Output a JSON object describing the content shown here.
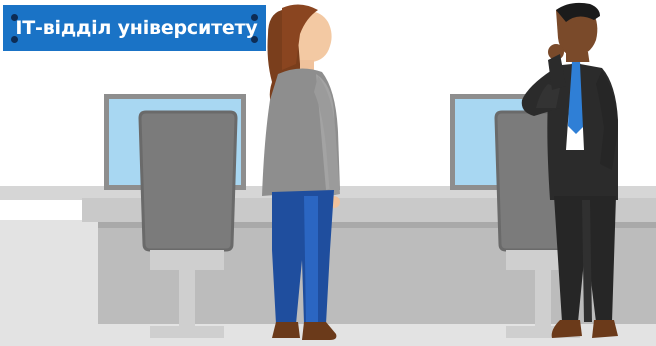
{
  "sign": {
    "text": "ІТ-відділ університету"
  },
  "colors": {
    "wall": "#ffffff",
    "floor_strip": "#dedede",
    "counter_top": "#c6c6c6",
    "counter_body": "#b7b7b7",
    "monitor_frame": "#8e8e8e",
    "monitor_screen": "#9fd1f0",
    "chair_back": "#7d7d7d",
    "chair_base": "#c8c8c8",
    "sign_bg": "#1a73c6"
  },
  "scene": {
    "people": [
      {
        "name": "woman",
        "hair": "#7a3e1c",
        "sweater": "#8a8a8a",
        "pants": "#1f4e9e",
        "shoes": "#6b3a1a"
      },
      {
        "name": "man",
        "suit": "#2a2a2a",
        "shirt": "#ffffff",
        "tie": "#2f7fd6",
        "shoes": "#6b3a1a",
        "skin": "#7a4a2a"
      }
    ]
  }
}
